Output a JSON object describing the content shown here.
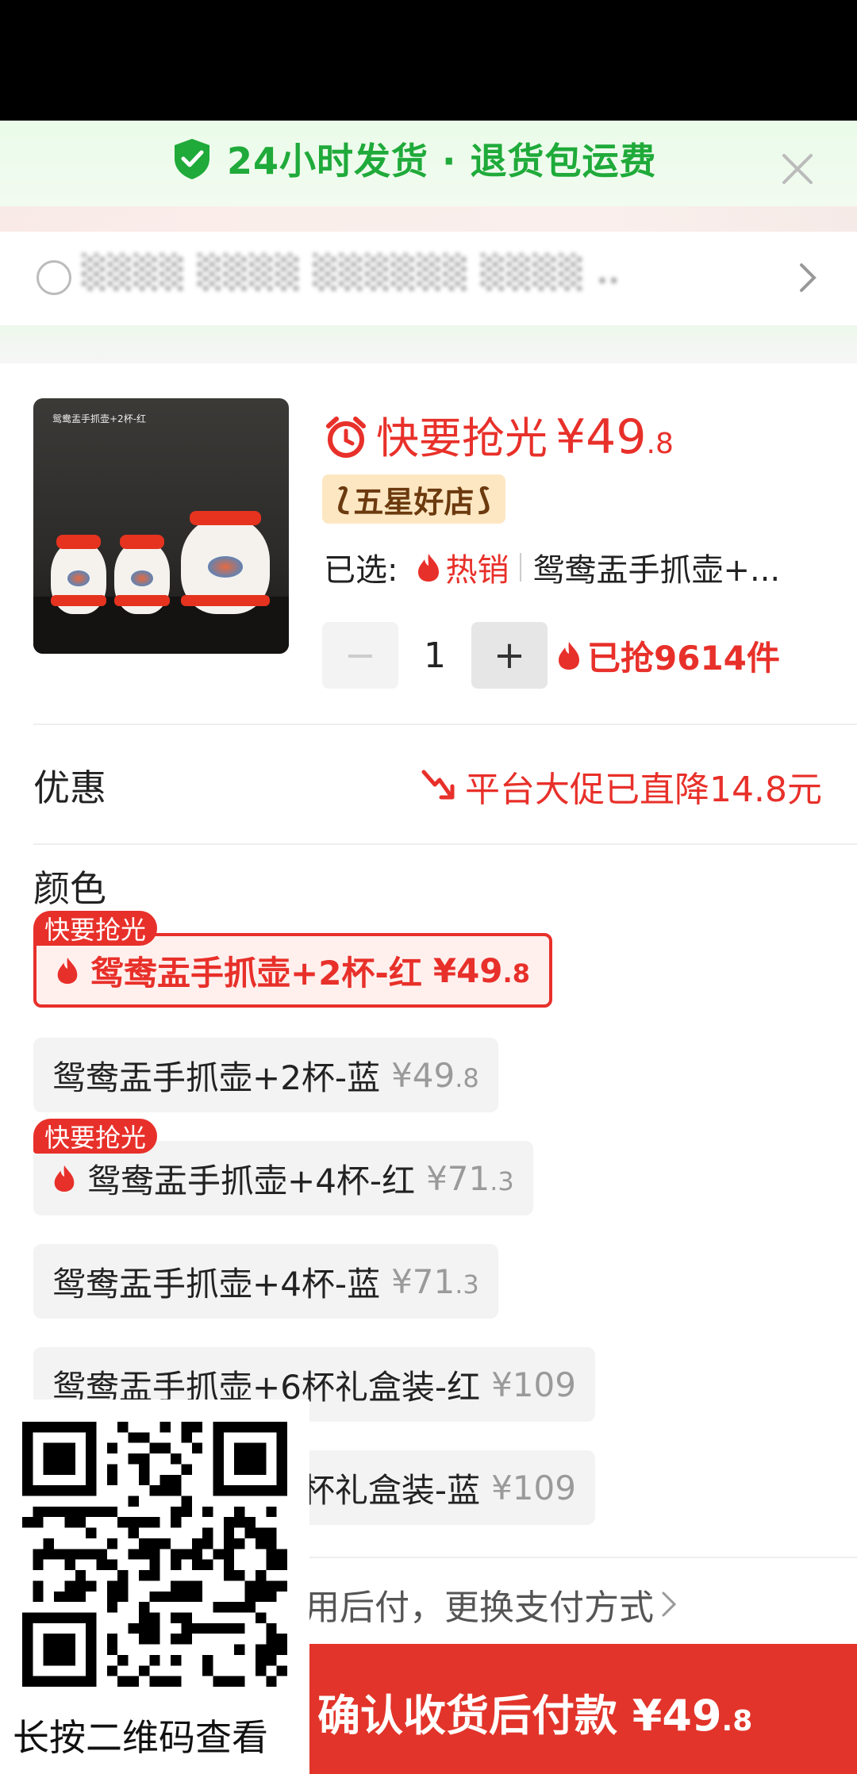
{
  "promo": {
    "text": "24小时发货 · 退货包运费",
    "close_icon": "close-icon",
    "color": "#1faa3a"
  },
  "address": {
    "text": "░░░░ ░░░░ ░░░░░░ ░░░░ .."
  },
  "product": {
    "thumb_caption": "鸳鸯盂手抓壶+2杯-红",
    "hurry_label": "快要抢光",
    "price_main": "¥49",
    "price_dec": ".8",
    "badge": "五星好店",
    "selected_label": "已选:",
    "hot_label": "热销",
    "selected_variant": "鸳鸯盂手抓壶+...",
    "qty_minus": "−",
    "qty_value": "1",
    "qty_plus": "+",
    "sold_text": "已抢9614件",
    "accent_color": "#e8302a"
  },
  "discount": {
    "label": "优惠",
    "value": "平台大促已直降14.8元"
  },
  "colors": {
    "title": "颜色",
    "tag_label": "快要抢光",
    "options": [
      {
        "name": "鸳鸯盂手抓壶+2杯-红",
        "price": "¥49",
        "dec": ".8",
        "selected": true,
        "hot": true
      },
      {
        "name": "鸳鸯盂手抓壶+2杯-蓝",
        "price": "¥49",
        "dec": ".8",
        "selected": false,
        "hot": false
      },
      {
        "name": "鸳鸯盂手抓壶+4杯-红",
        "price": "¥71",
        "dec": ".3",
        "selected": false,
        "hot": true
      },
      {
        "name": "鸳鸯盂手抓壶+4杯-蓝",
        "price": "¥71",
        "dec": ".3",
        "selected": false,
        "hot": false
      },
      {
        "name": "鸳鸯盂手抓壶+6杯礼盒装-红",
        "price": "¥109",
        "dec": "",
        "selected": false,
        "hot": false
      },
      {
        "name": "鸳鸯盂手抓壶+6杯礼盒装-蓝",
        "price": "¥109",
        "dec": "",
        "selected": false,
        "hot": false
      }
    ]
  },
  "payment": {
    "switch_text": "先用后付，更换支付方式",
    "confirm_text": "确认收货后付款 ¥49",
    "confirm_dec": ".8"
  },
  "qr": {
    "caption": "长按二维码查看"
  }
}
